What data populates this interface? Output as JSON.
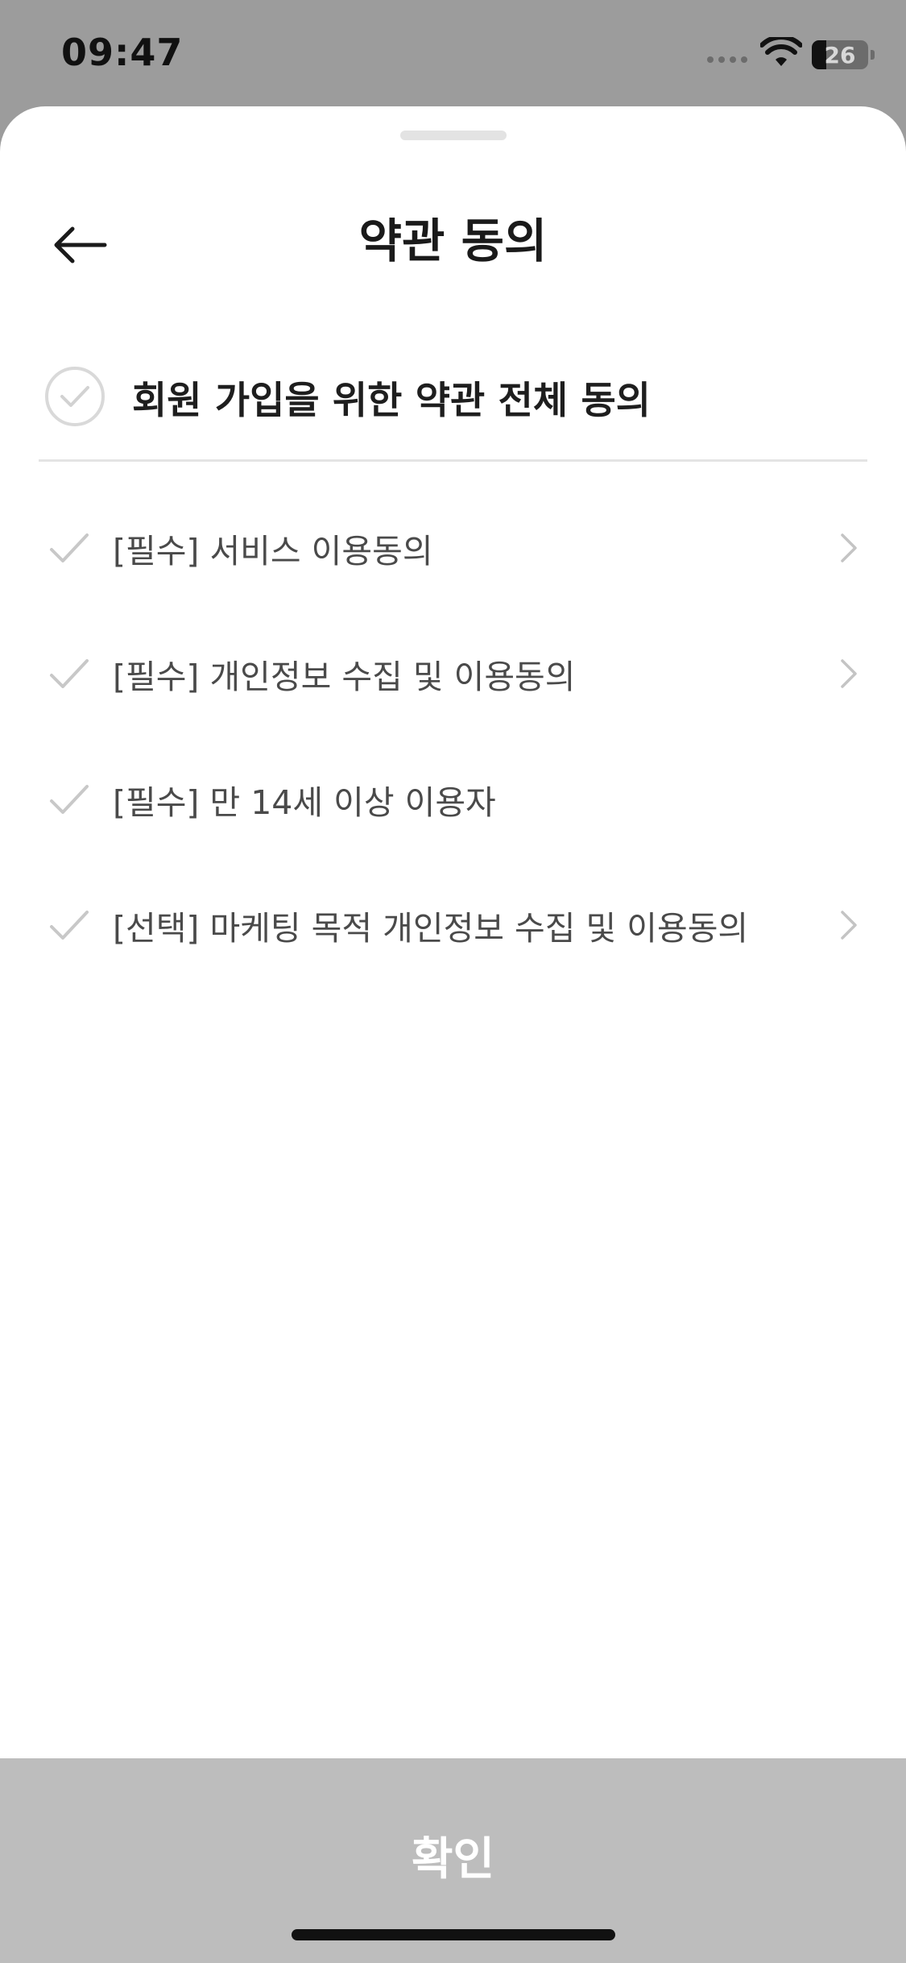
{
  "status_bar": {
    "time": "09:47",
    "battery_level": "26",
    "battery_fraction": 0.26
  },
  "header": {
    "title": "약관 동의",
    "back_icon": "arrow-left-icon"
  },
  "agree_all": {
    "label": "회원 가입을 위한 약관 전체 동의",
    "checked": false
  },
  "terms": [
    {
      "label": "[필수] 서비스 이용동의",
      "has_detail": true,
      "checked": false
    },
    {
      "label": "[필수] 개인정보 수집 및 이용동의",
      "has_detail": true,
      "checked": false
    },
    {
      "label": "[필수] 만 14세 이상 이용자",
      "has_detail": false,
      "checked": false
    },
    {
      "label": "[선택] 마케팅 목적 개인정보 수집 및 이용동의",
      "has_detail": true,
      "checked": false
    }
  ],
  "footer": {
    "confirm_label": "확인",
    "enabled": false
  },
  "colors": {
    "backdrop": "#9c9c9c",
    "sheet": "#ffffff",
    "title_text": "#1a1a1a",
    "term_text": "#4a4a4a",
    "inactive_check": "#c8c8c8",
    "confirm_disabled_bg": "#bdbdbd",
    "confirm_text": "#ffffff"
  }
}
